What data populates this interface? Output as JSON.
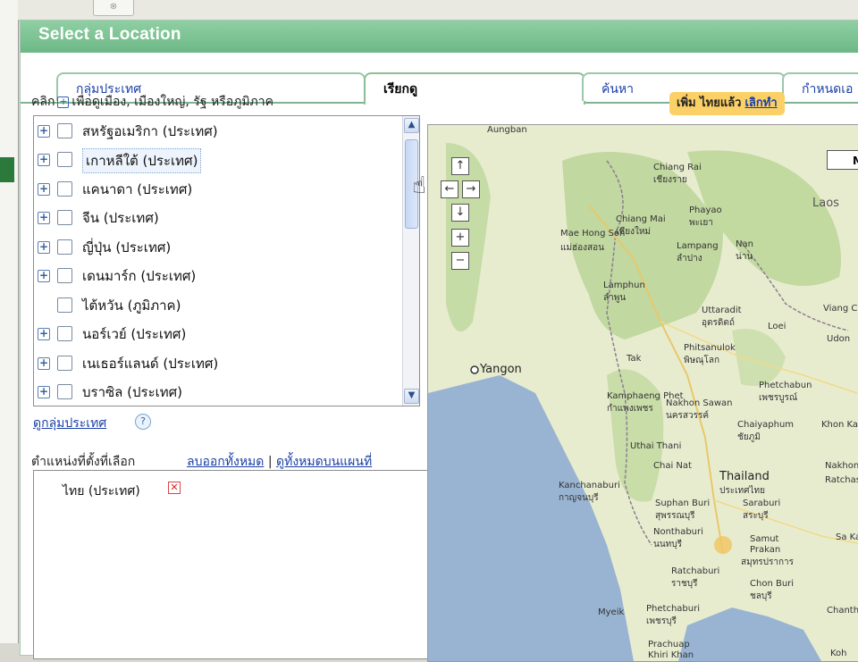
{
  "window": {
    "title": "Select a Location",
    "top_button_glyph": "⊗"
  },
  "tabs": [
    {
      "label": "กลุ่มประเทศ",
      "active": false
    },
    {
      "label": "เรียกดู",
      "active": true
    },
    {
      "label": "ค้นหา",
      "active": false
    },
    {
      "label": "กำหนดเอ",
      "active": false
    }
  ],
  "hint": {
    "prefix": "คลิก",
    "icon": "expand-icon",
    "suffix": "เพื่อดูเมือง, เมืองใหญ่, รัฐ หรือภูมิภาค"
  },
  "action_bar": {
    "text": "เพิ่ม ไทยแล้ว",
    "undo": "เลิกทำ",
    "color": "#fbd066"
  },
  "location_list": [
    {
      "label": "สหรัฐอเมริกา (ประเทศ)",
      "expandable": true
    },
    {
      "label": "เกาหลีใต้ (ประเทศ)",
      "expandable": true,
      "hovered": true
    },
    {
      "label": "แคนาดา (ประเทศ)",
      "expandable": true
    },
    {
      "label": "จีน (ประเทศ)",
      "expandable": true
    },
    {
      "label": "ญี่ปุ่น (ประเทศ)",
      "expandable": true
    },
    {
      "label": "เดนมาร์ก (ประเทศ)",
      "expandable": true
    },
    {
      "label": "ไต้หวัน (ภูมิภาค)",
      "expandable": false
    },
    {
      "label": "นอร์เวย์ (ประเทศ)",
      "expandable": true
    },
    {
      "label": "เนเธอร์แลนด์ (ประเทศ)",
      "expandable": true
    },
    {
      "label": "บราซิล (ประเทศ)",
      "expandable": true
    }
  ],
  "group_link": "ดูกลุ่มประเทศ",
  "help_glyph": "?",
  "selected": {
    "label": "ตำแหน่งที่ตั้งที่เลือก",
    "remove_all": "ลบออกทั้งหมด",
    "separator": "|",
    "view_all_on_map": "ดูทั้งหมดบนแผนที่",
    "items": [
      {
        "label": "ไทย (ประเทศ)"
      }
    ]
  },
  "map": {
    "map_button": "Map",
    "pan_up": "↑",
    "pan_left": "←",
    "pan_right": "→",
    "pan_down": "↓",
    "zoom_in": "+",
    "zoom_out": "−",
    "labels": {
      "aungban": "Aungban",
      "chiang_rai": "Chiang Rai",
      "chiang_rai_th": "เชียงราย",
      "mae_hong_son": "Mae Hong Son",
      "mae_hong_son_th": "แม่ฮ่องสอน",
      "chiang_mai": "Chiang Mai",
      "chiang_mai_th": "เชียงใหม่",
      "phayao": "Phayao",
      "phayao_th": "พะเยา",
      "lampang": "Lampang",
      "lampang_th": "ลำปาง",
      "nan": "Nan",
      "nan_th": "น่าน",
      "lamphun": "Lamphun",
      "lamphun_th": "ลำพูน",
      "laos": "Laos",
      "viang_chan": "Viang Chan",
      "uttaradit": "Uttaradit",
      "uttaradit_th": "อุตรดิตถ์",
      "loei": "Loei",
      "udon": "Udon",
      "yangon": "Yangon",
      "tak": "Tak",
      "phitsanulok": "Phitsanulok",
      "phitsanulok_th": "พิษณุโลก",
      "phetchabun": "Phetchabun",
      "phetchabun_th": "เพชรบูรณ์",
      "kamphaeng": "Kamphaeng Phet",
      "kamphaeng_th": "กำแพงเพชร",
      "nakhon_sawan": "Nakhon Sawan",
      "nakhon_sawan_th": "นครสวรรค์",
      "chaiyaphum": "Chaiyaphum",
      "chaiyaphum_th": "ชัยภูมิ",
      "khon_kaen": "Khon Kae",
      "uthai": "Uthai Thani",
      "chai_nat": "Chai Nat",
      "thailand": "Thailand",
      "thailand_th": "ประเทศไทย",
      "nakhon": "Nakhon",
      "ratchas": "Ratchas",
      "kanchanaburi": "Kanchanaburi",
      "kanchanaburi_th": "กาญจนบุรี",
      "suphan": "Suphan Buri",
      "suphan_th": "สุพรรณบุรี",
      "saraburi": "Saraburi",
      "saraburi_th": "สระบุรี",
      "nonthaburi": "Nonthaburi",
      "nonthaburi_th": "นนทบุรี",
      "samut": "Samut",
      "prakan": "Prakan",
      "samut_th": "สมุทรปราการ",
      "sa_kaeo": "Sa Kae",
      "ratchaburi": "Ratchaburi",
      "ratchaburi_th": "ราชบุรี",
      "chon_buri": "Chon Buri",
      "chon_buri_th": "ชลบุรี",
      "myeik": "Myeik",
      "phetchaburi": "Phetchaburi",
      "phetchaburi_th": "เพชรบุรี",
      "chanthaburi": "Chanthab",
      "prachuap": "Prachuap",
      "prachuap_th": "Khiri Khan",
      "koh": "Koh"
    }
  }
}
